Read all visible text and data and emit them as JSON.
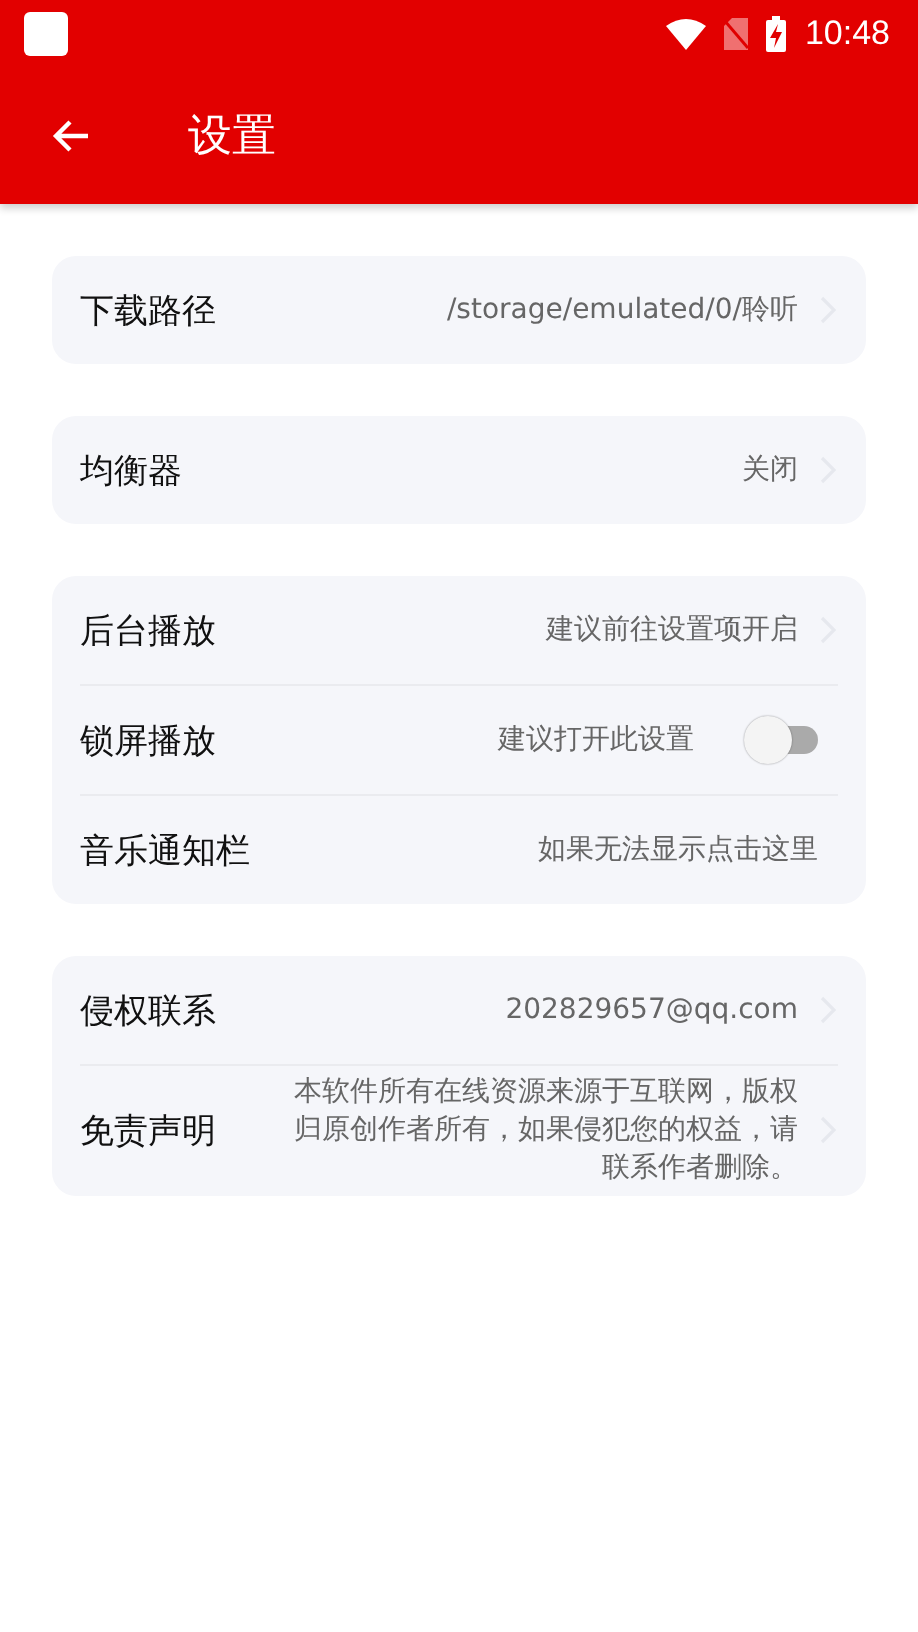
{
  "status_bar": {
    "time": "10:48"
  },
  "toolbar": {
    "title": "设置"
  },
  "groups": [
    {
      "rows": [
        {
          "kind": "link",
          "label": "下载路径",
          "value": "/storage/emulated/0/聆听",
          "chevron": true
        }
      ]
    },
    {
      "rows": [
        {
          "kind": "link",
          "label": "均衡器",
          "value": "关闭",
          "chevron": true
        }
      ]
    },
    {
      "rows": [
        {
          "kind": "link",
          "label": "后台播放",
          "value": "建议前往设置项开启",
          "chevron": true
        },
        {
          "kind": "toggle",
          "label": "锁屏播放",
          "value": "建议打开此设置",
          "on": false
        },
        {
          "kind": "link",
          "label": "音乐通知栏",
          "value": "如果无法显示点击这里",
          "chevron": false
        }
      ]
    },
    {
      "rows": [
        {
          "kind": "link",
          "label": "侵权联系",
          "value": "202829657@qq.com",
          "chevron": true
        },
        {
          "kind": "link",
          "label": "免责声明",
          "value": "本软件所有在线资源来源于互联网，版权归原创作者所有，如果侵犯您的权益，请联系作者删除。",
          "chevron": true
        }
      ]
    }
  ]
}
